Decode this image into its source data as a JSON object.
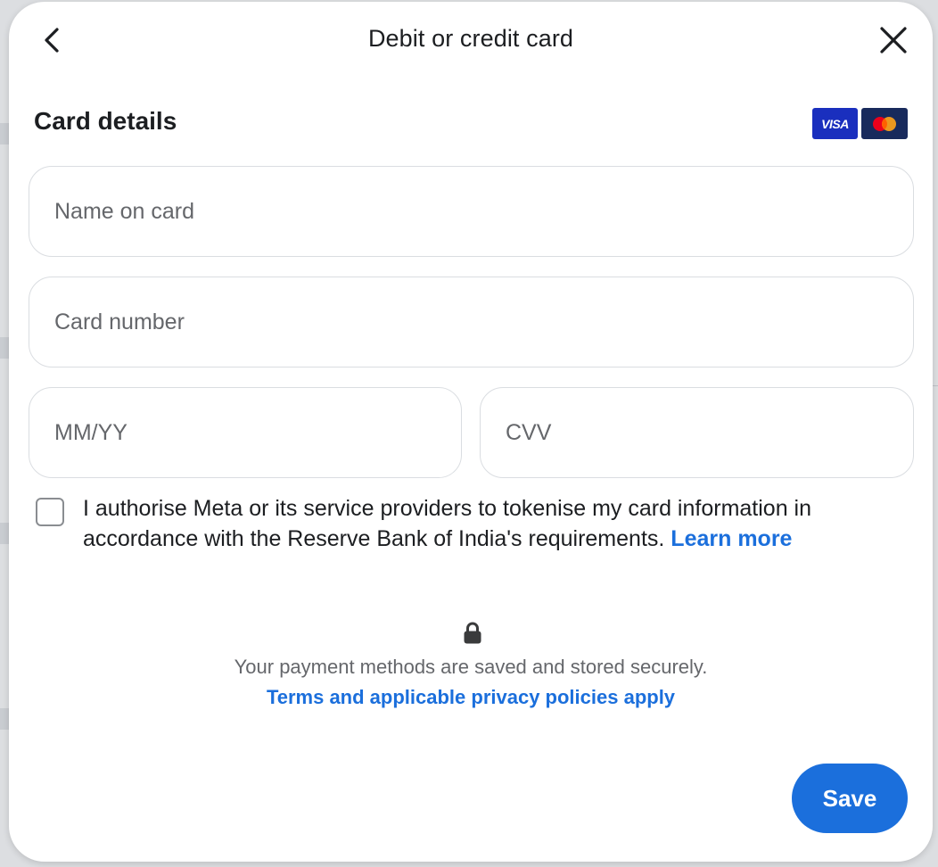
{
  "modal": {
    "title": "Debit or credit card",
    "back_icon": "chevron-left-icon",
    "close_icon": "close-icon"
  },
  "card_details": {
    "title": "Card details",
    "logos": {
      "visa_label": "VISA",
      "mastercard_icon": "mastercard-logo-icon"
    }
  },
  "fields": {
    "name_placeholder": "Name on card",
    "number_placeholder": "Card number",
    "expiry_placeholder": "MM/YY",
    "cvv_placeholder": "CVV"
  },
  "consent": {
    "checked": false,
    "text": "I authorise Meta or its service providers to tokenise my card information in accordance with the Reserve Bank of India's requirements.",
    "link_label": "Learn more"
  },
  "security": {
    "icon": "lock-icon",
    "message": "Your payment methods are saved and stored securely.",
    "terms_link": "Terms and applicable privacy policies apply"
  },
  "actions": {
    "save_label": "Save"
  },
  "colors": {
    "primary_blue": "#1b6fdc",
    "visa_blue": "#1a2fbe",
    "mastercard_navy": "#182a5c",
    "text_primary": "#1c1e21",
    "text_secondary": "#65676b"
  }
}
